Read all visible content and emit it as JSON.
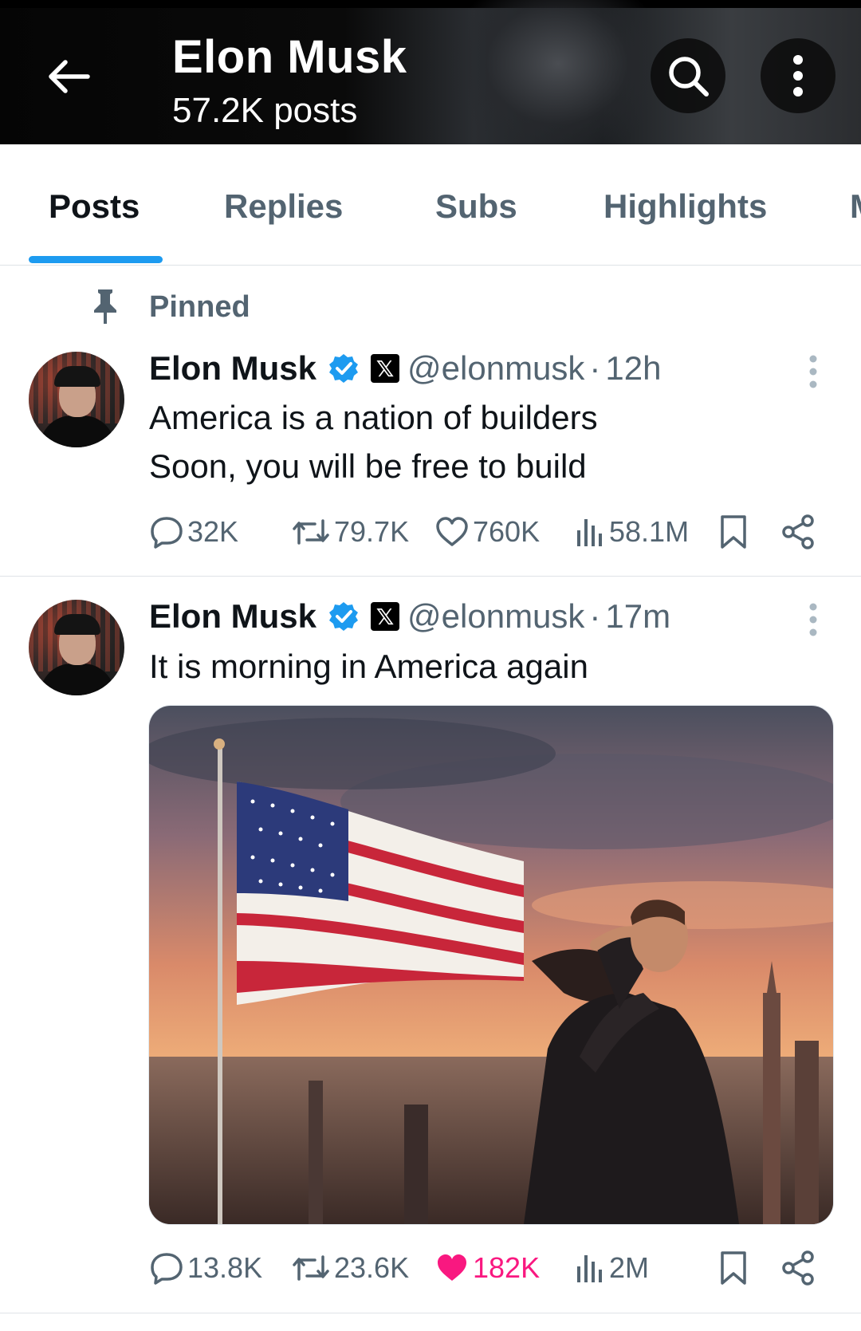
{
  "header": {
    "title": "Elon Musk",
    "subtitle": "57.2K posts",
    "icons": {
      "back": "arrow-left-icon",
      "search": "search-icon",
      "more": "more-vertical-icon"
    }
  },
  "tabs": [
    {
      "label": "Posts",
      "active": true
    },
    {
      "label": "Replies",
      "active": false
    },
    {
      "label": "Subs",
      "active": false
    },
    {
      "label": "Highlights",
      "active": false
    },
    {
      "label": "M",
      "active": false
    }
  ],
  "pinned_label": "Pinned",
  "posts": [
    {
      "author": "Elon Musk",
      "handle": "@elonmusk",
      "separator": "·",
      "time": "12h",
      "lines": [
        "America is a nation of builders",
        "Soon, you will be free to build"
      ],
      "stats": {
        "replies": "32K",
        "reposts": "79.7K",
        "likes": "760K",
        "views": "58.1M"
      },
      "liked": false
    },
    {
      "author": "Elon Musk",
      "handle": "@elonmusk",
      "separator": "·",
      "time": "17m",
      "lines": [
        "It is morning in America again"
      ],
      "stats": {
        "replies": "13.8K",
        "reposts": "23.6K",
        "likes": "182K",
        "views": "2M"
      },
      "liked": true,
      "has_media": true
    }
  ],
  "colors": {
    "accent": "#1d9bf0",
    "like": "#f91880",
    "muted": "#536471",
    "text": "#0f1419"
  }
}
